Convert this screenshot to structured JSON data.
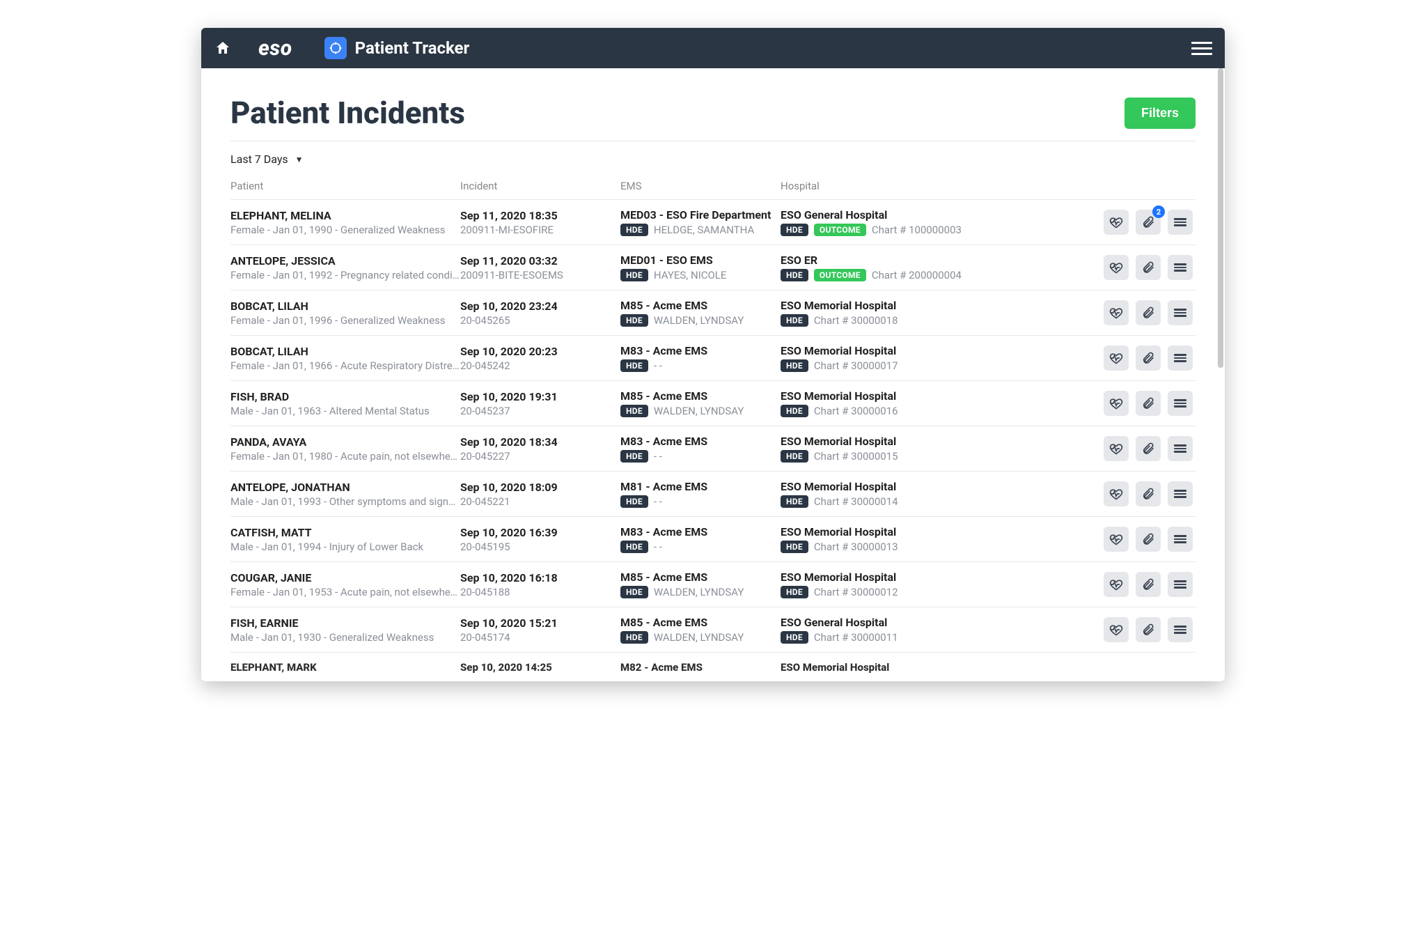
{
  "header": {
    "brand": "eso",
    "app_title": "Patient Tracker"
  },
  "page": {
    "title": "Patient Incidents",
    "filters_label": "Filters",
    "range_label": "Last 7 Days"
  },
  "columns": {
    "patient": "Patient",
    "incident": "Incident",
    "ems": "EMS",
    "hospital": "Hospital"
  },
  "badges": {
    "hde": "HDE",
    "outcome": "OUTCOME"
  },
  "rows": [
    {
      "patient_name": "ELEPHANT, MELINA",
      "patient_sub": "Female - Jan 01, 1990 - Generalized Weakness",
      "incident_time": "Sep 11, 2020 18:35",
      "incident_id": "200911-MI-ESOFIRE",
      "ems_name": "MED03 - ESO Fire Department",
      "ems_person": "HELDGE, SAMANTHA",
      "hospital_name": "ESO General Hospital",
      "has_outcome": true,
      "chart_text": "Chart # 100000003",
      "attachment_count": 2
    },
    {
      "patient_name": "ANTELOPE, JESSICA",
      "patient_sub": "Female - Jan 01, 1992 - Pregnancy related condi…",
      "incident_time": "Sep 11, 2020 03:32",
      "incident_id": "200911-BITE-ESOEMS",
      "ems_name": "MED01 - ESO EMS",
      "ems_person": "HAYES, NICOLE",
      "hospital_name": "ESO ER",
      "has_outcome": true,
      "chart_text": "Chart # 200000004",
      "attachment_count": 0
    },
    {
      "patient_name": "BOBCAT, LILAH",
      "patient_sub": "Female - Jan 01, 1996 - Generalized Weakness",
      "incident_time": "Sep 10, 2020 23:24",
      "incident_id": "20-045265",
      "ems_name": "M85 - Acme EMS",
      "ems_person": "WALDEN, LYNDSAY",
      "hospital_name": "ESO Memorial Hospital",
      "has_outcome": false,
      "chart_text": "Chart # 30000018",
      "attachment_count": 0
    },
    {
      "patient_name": "BOBCAT, LILAH",
      "patient_sub": "Female - Jan 01, 1966 - Acute Respiratory Distre…",
      "incident_time": "Sep 10, 2020 20:23",
      "incident_id": "20-045242",
      "ems_name": "M83 - Acme EMS",
      "ems_person": "- -",
      "hospital_name": "ESO Memorial Hospital",
      "has_outcome": false,
      "chart_text": "Chart # 30000017",
      "attachment_count": 0
    },
    {
      "patient_name": "FISH, BRAD",
      "patient_sub": "Male - Jan 01, 1963 - Altered Mental Status",
      "incident_time": "Sep 10, 2020 19:31",
      "incident_id": "20-045237",
      "ems_name": "M85 - Acme EMS",
      "ems_person": "WALDEN, LYNDSAY",
      "hospital_name": "ESO Memorial Hospital",
      "has_outcome": false,
      "chart_text": "Chart # 30000016",
      "attachment_count": 0
    },
    {
      "patient_name": "PANDA, AVAYA",
      "patient_sub": "Female - Jan 01, 1980 - Acute pain, not elsewhe…",
      "incident_time": "Sep 10, 2020 18:34",
      "incident_id": "20-045227",
      "ems_name": "M83 - Acme EMS",
      "ems_person": "- -",
      "hospital_name": "ESO Memorial Hospital",
      "has_outcome": false,
      "chart_text": "Chart # 30000015",
      "attachment_count": 0
    },
    {
      "patient_name": "ANTELOPE, JONATHAN",
      "patient_sub": "Male - Jan 01, 1993 - Other symptoms and signs…",
      "incident_time": "Sep 10, 2020 18:09",
      "incident_id": "20-045221",
      "ems_name": "M81 - Acme EMS",
      "ems_person": "- -",
      "hospital_name": "ESO Memorial Hospital",
      "has_outcome": false,
      "chart_text": "Chart # 30000014",
      "attachment_count": 0
    },
    {
      "patient_name": "CATFISH, MATT",
      "patient_sub": "Male - Jan 01, 1994 - Injury of Lower Back",
      "incident_time": "Sep 10, 2020 16:39",
      "incident_id": "20-045195",
      "ems_name": "M83 - Acme EMS",
      "ems_person": "- -",
      "hospital_name": "ESO Memorial Hospital",
      "has_outcome": false,
      "chart_text": "Chart # 30000013",
      "attachment_count": 0
    },
    {
      "patient_name": "COUGAR, JANIE",
      "patient_sub": "Female - Jan 01, 1953 - Acute pain, not elsewhe…",
      "incident_time": "Sep 10, 2020 16:18",
      "incident_id": "20-045188",
      "ems_name": "M85 - Acme EMS",
      "ems_person": "WALDEN, LYNDSAY",
      "hospital_name": "ESO Memorial Hospital",
      "has_outcome": false,
      "chart_text": "Chart # 30000012",
      "attachment_count": 0
    },
    {
      "patient_name": "FISH, EARNIE",
      "patient_sub": "Male - Jan 01, 1930 - Generalized Weakness",
      "incident_time": "Sep 10, 2020 15:21",
      "incident_id": "20-045174",
      "ems_name": "M85 - Acme EMS",
      "ems_person": "WALDEN, LYNDSAY",
      "hospital_name": "ESO General Hospital",
      "has_outcome": false,
      "chart_text": "Chart # 30000011",
      "attachment_count": 0
    }
  ],
  "cut_row": {
    "patient_name": "ELEPHANT, MARK",
    "incident_time": "Sep 10, 2020 14:25",
    "ems_name": "M82 - Acme EMS",
    "hospital_name": "ESO Memorial Hospital"
  }
}
